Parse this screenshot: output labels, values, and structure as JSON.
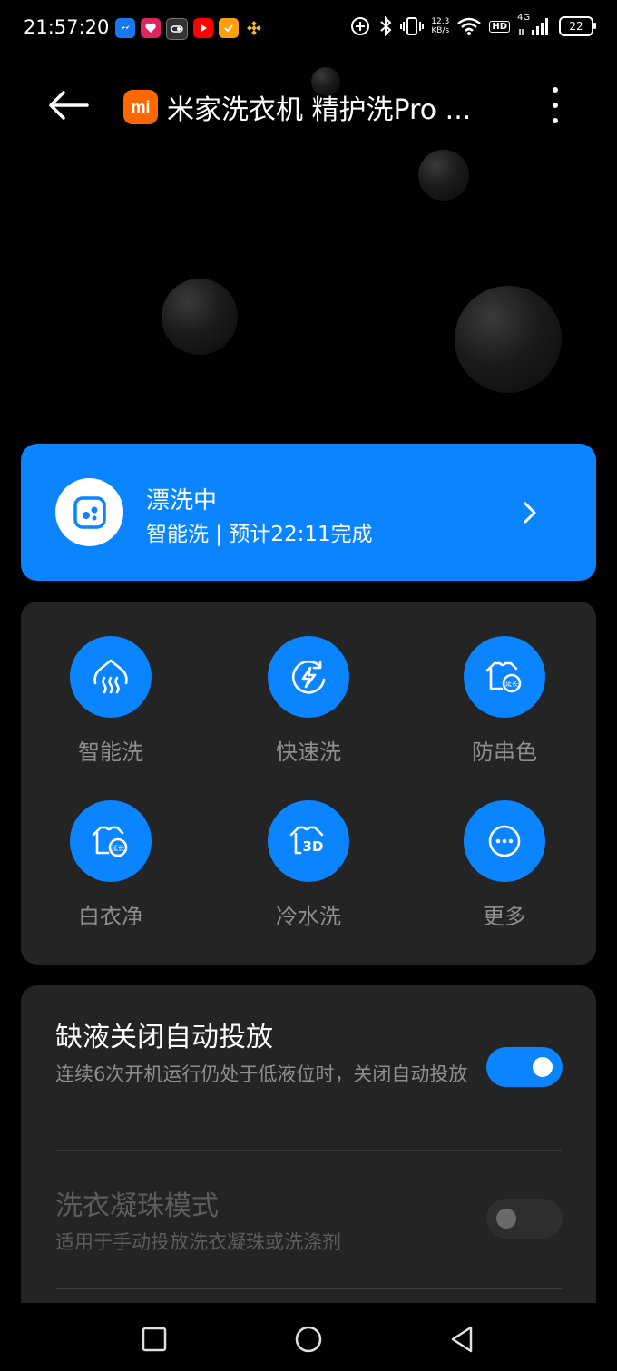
{
  "status_bar": {
    "time": "21:57:20",
    "net_speed_value": "12.3",
    "net_speed_unit": "KB/s",
    "hd": "HD",
    "network": "4G",
    "battery": "22",
    "app_icons": [
      "messenger-icon",
      "heart-app-icon",
      "toggle-app-icon",
      "youtube-icon",
      "orange-app-icon",
      "binance-icon"
    ]
  },
  "header": {
    "logo_text": "mi",
    "title": "米家洗衣机 精护洗Pro ..."
  },
  "status_card": {
    "title": "漂洗中",
    "subtitle": "智能洗 | 预计22:11完成"
  },
  "modes": [
    {
      "label": "智能洗",
      "icon": "smart-wash-icon"
    },
    {
      "label": "快速洗",
      "icon": "quick-wash-icon"
    },
    {
      "label": "防串色",
      "icon": "color-protect-icon"
    },
    {
      "label": "白衣净",
      "icon": "white-clothes-icon"
    },
    {
      "label": "冷水洗",
      "icon": "cold-wash-3d-icon"
    },
    {
      "label": "更多",
      "icon": "more-icon"
    }
  ],
  "settings": [
    {
      "title": "缺液关闭自动投放",
      "description": "连续6次开机运行仍处于低液位时，关闭自动投放",
      "enabled": true,
      "active": true
    },
    {
      "title": "洗衣凝珠模式",
      "description": "适用于手动投放洗衣凝珠或洗涤剂",
      "enabled": false,
      "active": false
    }
  ],
  "colors": {
    "accent": "#0a84ff",
    "card": "#242424",
    "background": "#000000",
    "brand": "#ff6700"
  }
}
